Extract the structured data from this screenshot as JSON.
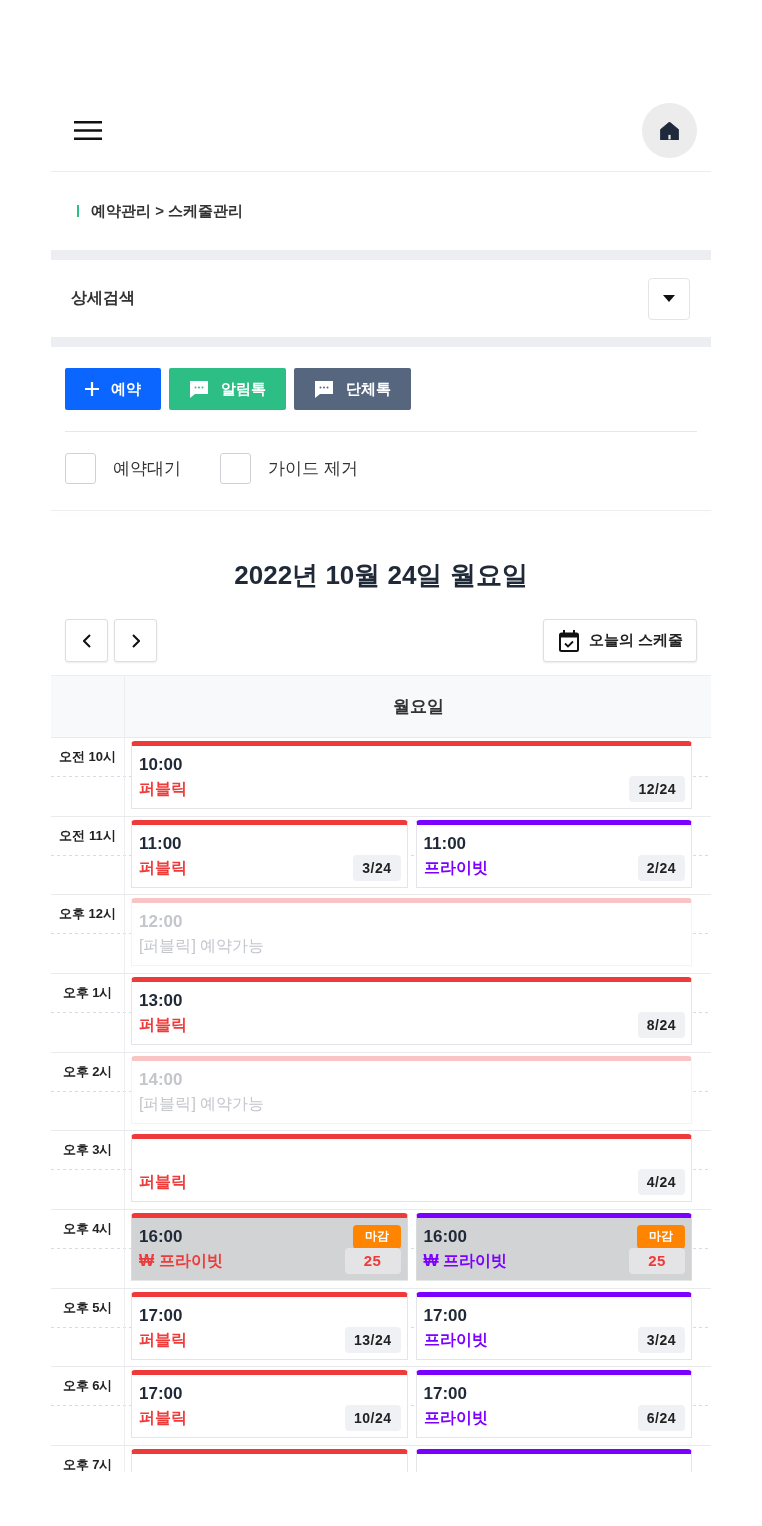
{
  "header": {
    "breadcrumb": "예약관리 > 스케줄관리"
  },
  "search_panel": {
    "title": "상세검색",
    "expanded": false
  },
  "actions": [
    {
      "kind": "plus",
      "label": "예약",
      "color": "#0a66ff"
    },
    {
      "kind": "chat",
      "label": "알림톡",
      "color": "#2dbe86"
    },
    {
      "kind": "chat",
      "label": "단체톡",
      "color": "#56667e"
    }
  ],
  "filters": [
    {
      "label": "예약대기",
      "checked": false
    },
    {
      "label": "가이드 제거",
      "checked": false
    }
  ],
  "date_title": "2022년 10월 24일 월요일",
  "today_button": {
    "label": "오늘의 스케줄"
  },
  "schedule": {
    "day_header": "월요일",
    "rows": [
      {
        "time_label": "오전 10시",
        "slots": [
          {
            "kind": "booked",
            "color": "#ef3a3a",
            "time": "10:00",
            "type": "퍼블릭",
            "count": "12/24"
          }
        ]
      },
      {
        "time_label": "오전 11시",
        "slots": [
          {
            "kind": "booked",
            "color": "#ef3a3a",
            "time": "11:00",
            "type": "퍼블릭",
            "count": "3/24"
          },
          {
            "kind": "booked",
            "color": "#7b00ff",
            "time": "11:00",
            "type": "프라이빗",
            "count": "2/24"
          }
        ]
      },
      {
        "time_label": "오후 12시",
        "slots": [
          {
            "kind": "available",
            "color": "#f9c4c4",
            "time": "12:00",
            "type": "[퍼블릭] 예약가능"
          }
        ]
      },
      {
        "time_label": "오후 1시",
        "slots": [
          {
            "kind": "booked",
            "color": "#ef3a3a",
            "time": "13:00",
            "type": "퍼블릭",
            "count": "8/24"
          }
        ]
      },
      {
        "time_label": "오후 2시",
        "slots": [
          {
            "kind": "available",
            "color": "#f9c4c4",
            "time": "14:00",
            "type": "[퍼블릭] 예약가능"
          }
        ]
      },
      {
        "time_label": "오후 3시",
        "slots": [
          {
            "kind": "booked",
            "color": "#ef3a3a",
            "type": "퍼블릭",
            "count": "4/24"
          }
        ]
      },
      {
        "time_label": "오후 4시",
        "slots": [
          {
            "kind": "closed",
            "color": "#ef3a3a",
            "time": "16:00",
            "badge": "마감",
            "type": "₩ 프라이빗",
            "count": "25"
          },
          {
            "kind": "closed",
            "color": "#7b00ff",
            "time": "16:00",
            "badge": "마감",
            "type": "₩ 프라이빗",
            "count": "25"
          }
        ]
      },
      {
        "time_label": "오후 5시",
        "slots": [
          {
            "kind": "booked",
            "color": "#ef3a3a",
            "time": "17:00",
            "type": "퍼블릭",
            "count": "13/24"
          },
          {
            "kind": "booked",
            "color": "#7b00ff",
            "time": "17:00",
            "type": "프라이빗",
            "count": "3/24"
          }
        ]
      },
      {
        "time_label": "오후 6시",
        "slots": [
          {
            "kind": "booked",
            "color": "#ef3a3a",
            "time": "17:00",
            "type": "퍼블릭",
            "count": "10/24"
          },
          {
            "kind": "booked",
            "color": "#7b00ff",
            "time": "17:00",
            "type": "프라이빗",
            "count": "6/24"
          }
        ]
      },
      {
        "time_label": "오후 7시",
        "slots": [
          {
            "kind": "booked",
            "color": "#ef3a3a"
          },
          {
            "kind": "booked",
            "color": "#7b00ff"
          }
        ]
      }
    ]
  }
}
